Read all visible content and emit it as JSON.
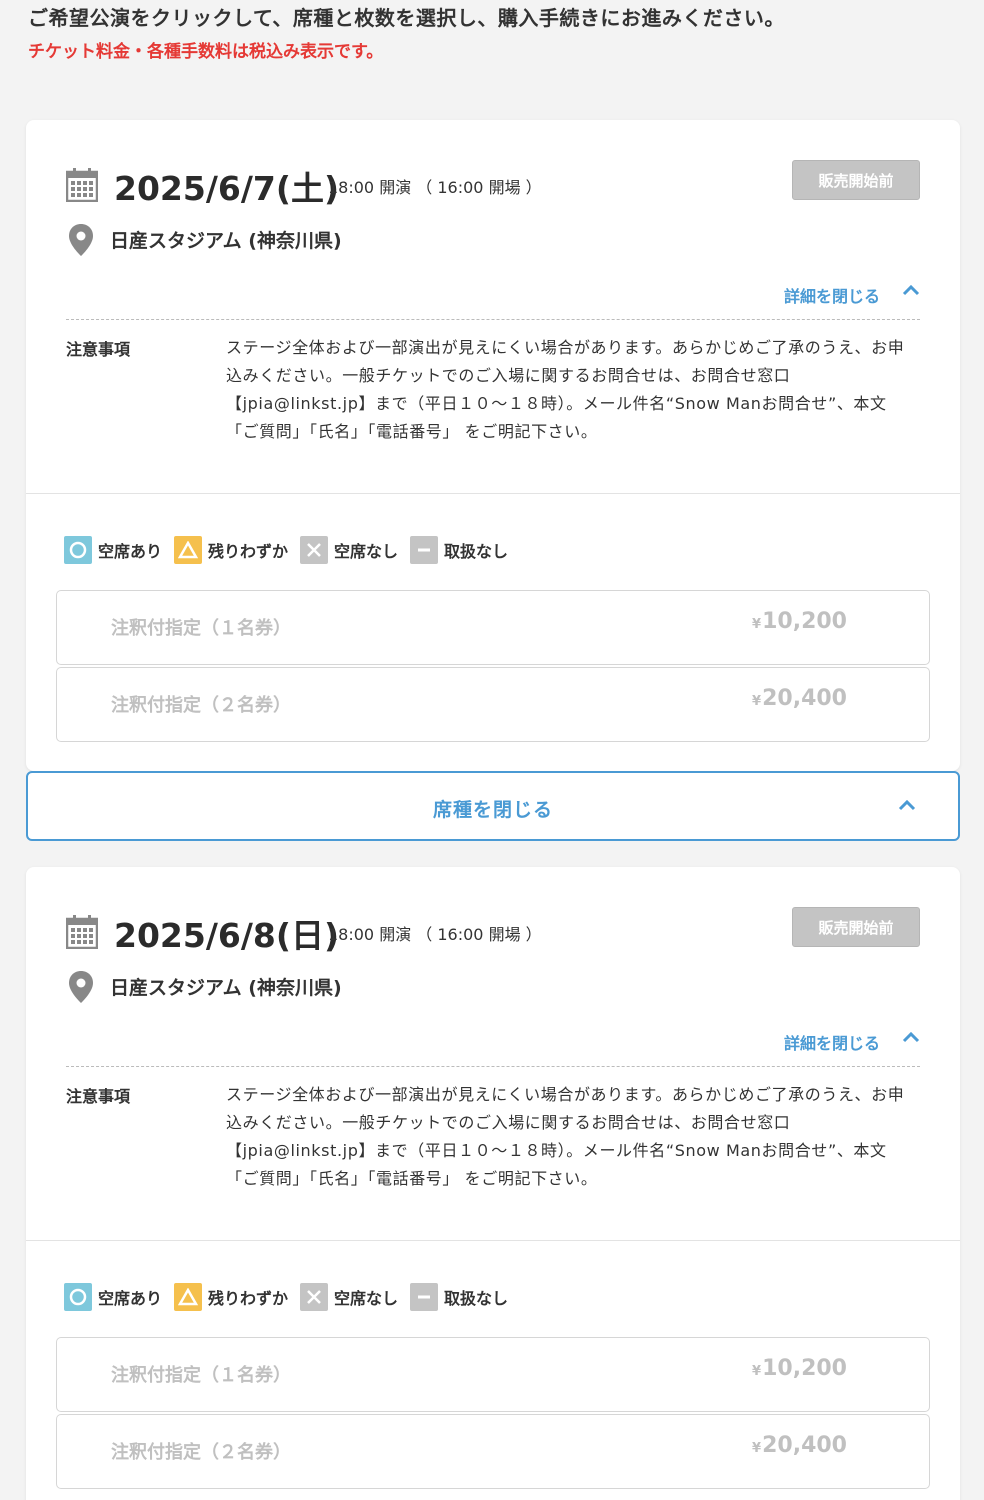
{
  "intro": {
    "instruction": "ご希望公演をクリックして、席種と枚数を選択し、購入手続きにお進みください。",
    "tax_note": "チケット料金・各種手数料は税込み表示です。"
  },
  "colors": {
    "accent": "#4a9ad4",
    "warning": "#e53935",
    "vacant": "#7ec8dc",
    "few": "#f5c04d",
    "none": "#c4c4c4"
  },
  "legend": {
    "available": "空席あり",
    "few_left": "残りわずか",
    "sold_out": "空席なし",
    "not_handled": "取扱なし"
  },
  "close_seat_label": "席種を閉じる",
  "performances": [
    {
      "date": "2025/6/7(土)",
      "time": "18:00 開演 （ 16:00 開場 ）",
      "status": "販売開始前",
      "venue": "日産スタジアム (神奈川県)",
      "detail_toggle": "詳細を閉じる",
      "notes_label": "注意事項",
      "notes": "ステージ全体および一部演出が見えにくい場合があります。あらかじめご了承のうえ、お申込みください。一般チケットでのご入場に関するお問合せは、お問合せ窓口【jpia@linkst.jp】まで（平日１０～１８時）。メール件名“Snow Manお問合せ”、本文 「ご質問」「氏名」「電話番号」 をご明記下さい。",
      "seats": [
        {
          "name": "注釈付指定（１名券）",
          "currency": "¥",
          "price": "10,200"
        },
        {
          "name": "注釈付指定（２名券）",
          "currency": "¥",
          "price": "20,400"
        }
      ]
    },
    {
      "date": "2025/6/8(日)",
      "time": "18:00 開演 （ 16:00 開場 ）",
      "status": "販売開始前",
      "venue": "日産スタジアム (神奈川県)",
      "detail_toggle": "詳細を閉じる",
      "notes_label": "注意事項",
      "notes": "ステージ全体および一部演出が見えにくい場合があります。あらかじめご了承のうえ、お申込みください。一般チケットでのご入場に関するお問合せは、お問合せ窓口【jpia@linkst.jp】まで（平日１０～１８時）。メール件名“Snow Manお問合せ”、本文 「ご質問」「氏名」「電話番号」 をご明記下さい。",
      "seats": [
        {
          "name": "注釈付指定（１名券）",
          "currency": "¥",
          "price": "10,200"
        },
        {
          "name": "注釈付指定（２名券）",
          "currency": "¥",
          "price": "20,400"
        }
      ]
    }
  ]
}
